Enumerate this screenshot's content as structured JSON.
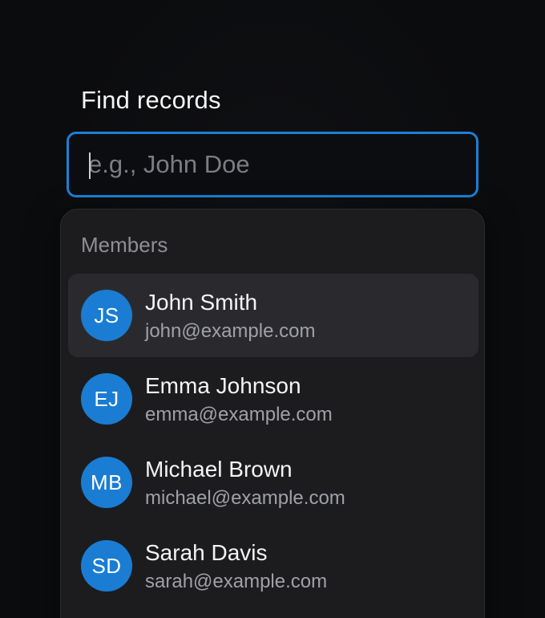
{
  "search": {
    "label": "Find records",
    "placeholder": "e.g., John Doe",
    "value": ""
  },
  "dropdown": {
    "group_label": "Members",
    "options": [
      {
        "initials": "JS",
        "name": "John Smith",
        "email": "john@example.com",
        "highlighted": true
      },
      {
        "initials": "EJ",
        "name": "Emma Johnson",
        "email": "emma@example.com",
        "highlighted": false
      },
      {
        "initials": "MB",
        "name": "Michael Brown",
        "email": "michael@example.com",
        "highlighted": false
      },
      {
        "initials": "SD",
        "name": "Sarah Davis",
        "email": "sarah@example.com",
        "highlighted": false
      }
    ]
  },
  "colors": {
    "accent": "#1b7fd6",
    "avatar": "#1a7dd3",
    "background": "#0b0c0e",
    "panel": "#1c1c1f",
    "highlight": "#2a2a2e"
  }
}
